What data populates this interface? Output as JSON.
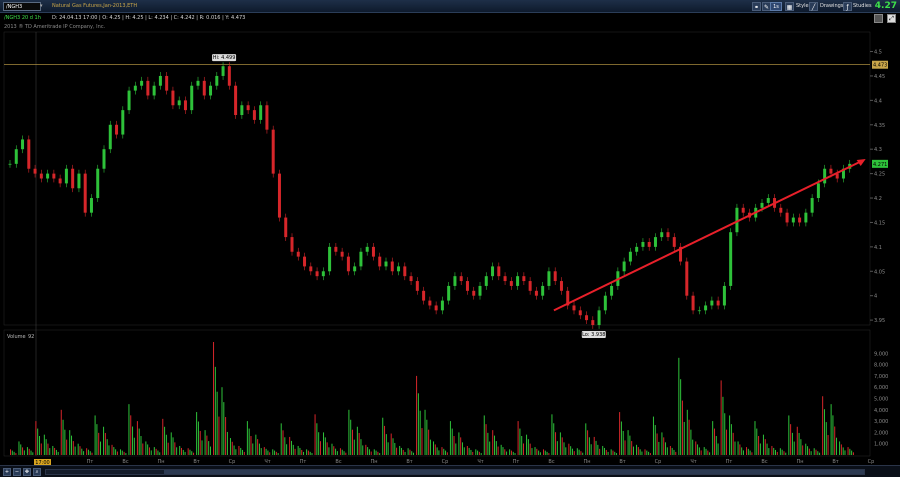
{
  "toolbar": {
    "symbol": "/NGH3",
    "symbol_description": "Natural Gas Futures,Jan-2013,ETH",
    "interval": "1s",
    "style_label": "Style",
    "drawings_label": "Drawings",
    "studies_label": "Studies",
    "last_price": "4.27",
    "price_color": "#3ee04a"
  },
  "info": {
    "chart_label": "/NGH3 20 d 1h",
    "ohlc": "D: 24.04.13 17:00 | O: 4.25 | H: 4.25 | L: 4.234 | C: 4.242 | R: 0.016 | Y: 4.473",
    "copyright": "2013 ® TD Ameritrade IP Company, Inc."
  },
  "volume_header": {
    "label": "Volume",
    "value": "92"
  },
  "time_marker": "17:00",
  "chart_data": [
    {
      "type": "candlestick",
      "ylim": [
        3.94,
        4.54
      ],
      "yticks": [
        3.95,
        4,
        4.05,
        4.1,
        4.15,
        4.2,
        4.25,
        4.3,
        4.35,
        4.4,
        4.45,
        4.5
      ],
      "yticklabels": [
        "3.95",
        "4",
        "4.05",
        "4.1",
        "4.15",
        "4.2",
        "4.25",
        "4.3",
        "4.35",
        "4.4",
        "4.45",
        "4.5"
      ],
      "xticklabels": [
        "Пт",
        "Вс",
        "Пн",
        "Вт",
        "Ср",
        "Чт",
        "Пт",
        "Вс",
        "Пн",
        "Вт",
        "Ср",
        "Чт",
        "Пт",
        "Вс",
        "Пн",
        "Вт",
        "Ср",
        "Чт",
        "Пт",
        "Вс",
        "Пн",
        "Вт",
        "Ср"
      ],
      "hi_label": "Hi: 4.499",
      "lo_label": "Lo: 3.938",
      "hline_value": 4.473,
      "hline_label": "4.473",
      "last_label": "4.271",
      "close_series": [
        4.27,
        4.3,
        4.32,
        4.26,
        4.25,
        4.24,
        4.25,
        4.24,
        4.23,
        4.26,
        4.22,
        4.25,
        4.17,
        4.2,
        4.26,
        4.3,
        4.35,
        4.33,
        4.38,
        4.42,
        4.43,
        4.44,
        4.41,
        4.43,
        4.45,
        4.42,
        4.39,
        4.4,
        4.38,
        4.43,
        4.44,
        4.41,
        4.43,
        4.45,
        4.47,
        4.43,
        4.37,
        4.39,
        4.38,
        4.36,
        4.39,
        4.34,
        4.25,
        4.16,
        4.12,
        4.09,
        4.08,
        4.06,
        4.05,
        4.04,
        4.05,
        4.1,
        4.09,
        4.08,
        4.05,
        4.06,
        4.09,
        4.1,
        4.08,
        4.06,
        4.07,
        4.05,
        4.06,
        4.04,
        4.03,
        4.01,
        3.99,
        3.98,
        3.97,
        3.99,
        4.02,
        4.04,
        4.03,
        4.01,
        4.0,
        4.02,
        4.04,
        4.06,
        4.04,
        4.03,
        4.02,
        4.04,
        4.03,
        4.01,
        4.0,
        4.02,
        4.05,
        4.03,
        4.01,
        3.98,
        3.97,
        3.96,
        3.95,
        3.94,
        3.97,
        4.0,
        4.02,
        4.05,
        4.07,
        4.09,
        4.1,
        4.11,
        4.1,
        4.12,
        4.13,
        4.12,
        4.1,
        4.07,
        4.0,
        3.97,
        3.97,
        3.98,
        3.99,
        3.98,
        4.02,
        4.13,
        4.18,
        4.17,
        4.16,
        4.18,
        4.19,
        4.2,
        4.18,
        4.17,
        4.15,
        4.16,
        4.15,
        4.17,
        4.2,
        4.23,
        4.26,
        4.25,
        4.24,
        4.26,
        4.27
      ],
      "trendline": {
        "from": [
          0.635,
          3.97
        ],
        "to": [
          0.995,
          4.28
        ],
        "color": "#e8202a"
      }
    },
    {
      "type": "bar",
      "name": "Volume",
      "ylim": [
        0,
        10000
      ],
      "yticklabels": [
        "1,000",
        "2,000",
        "3,000",
        "4,000",
        "5,000",
        "6,000",
        "7,000",
        "8,000",
        "9,000"
      ],
      "spikes": [
        0.05,
        0.12,
        0.07,
        0.3,
        0.18,
        0.08,
        0.4,
        0.22,
        0.1,
        0.06,
        0.35,
        0.25,
        0.09,
        0.05,
        0.45,
        0.3,
        0.12,
        0.07,
        0.32,
        0.2,
        0.08,
        0.06,
        0.38,
        0.22,
        1.0,
        0.6,
        0.15,
        0.08,
        0.3,
        0.18,
        0.07,
        0.05,
        0.28,
        0.16,
        0.08,
        0.05,
        0.36,
        0.2,
        0.1,
        0.06,
        0.4,
        0.25,
        0.09,
        0.05,
        0.33,
        0.19,
        0.08,
        0.06,
        0.7,
        0.4,
        0.12,
        0.07,
        0.3,
        0.2,
        0.08,
        0.05,
        0.35,
        0.22,
        0.09,
        0.05,
        0.3,
        0.18,
        0.07,
        0.05,
        0.36,
        0.2,
        0.1,
        0.06,
        0.28,
        0.16,
        0.08,
        0.05,
        0.38,
        0.22,
        0.09,
        0.05,
        0.34,
        0.2,
        0.08,
        0.86,
        0.4,
        0.12,
        0.07,
        0.3,
        0.66,
        0.35,
        0.12,
        0.07,
        0.3,
        0.18,
        0.08,
        0.06,
        0.35,
        0.25,
        0.1,
        0.06,
        0.52,
        0.45,
        0.12,
        0.07
      ]
    }
  ]
}
